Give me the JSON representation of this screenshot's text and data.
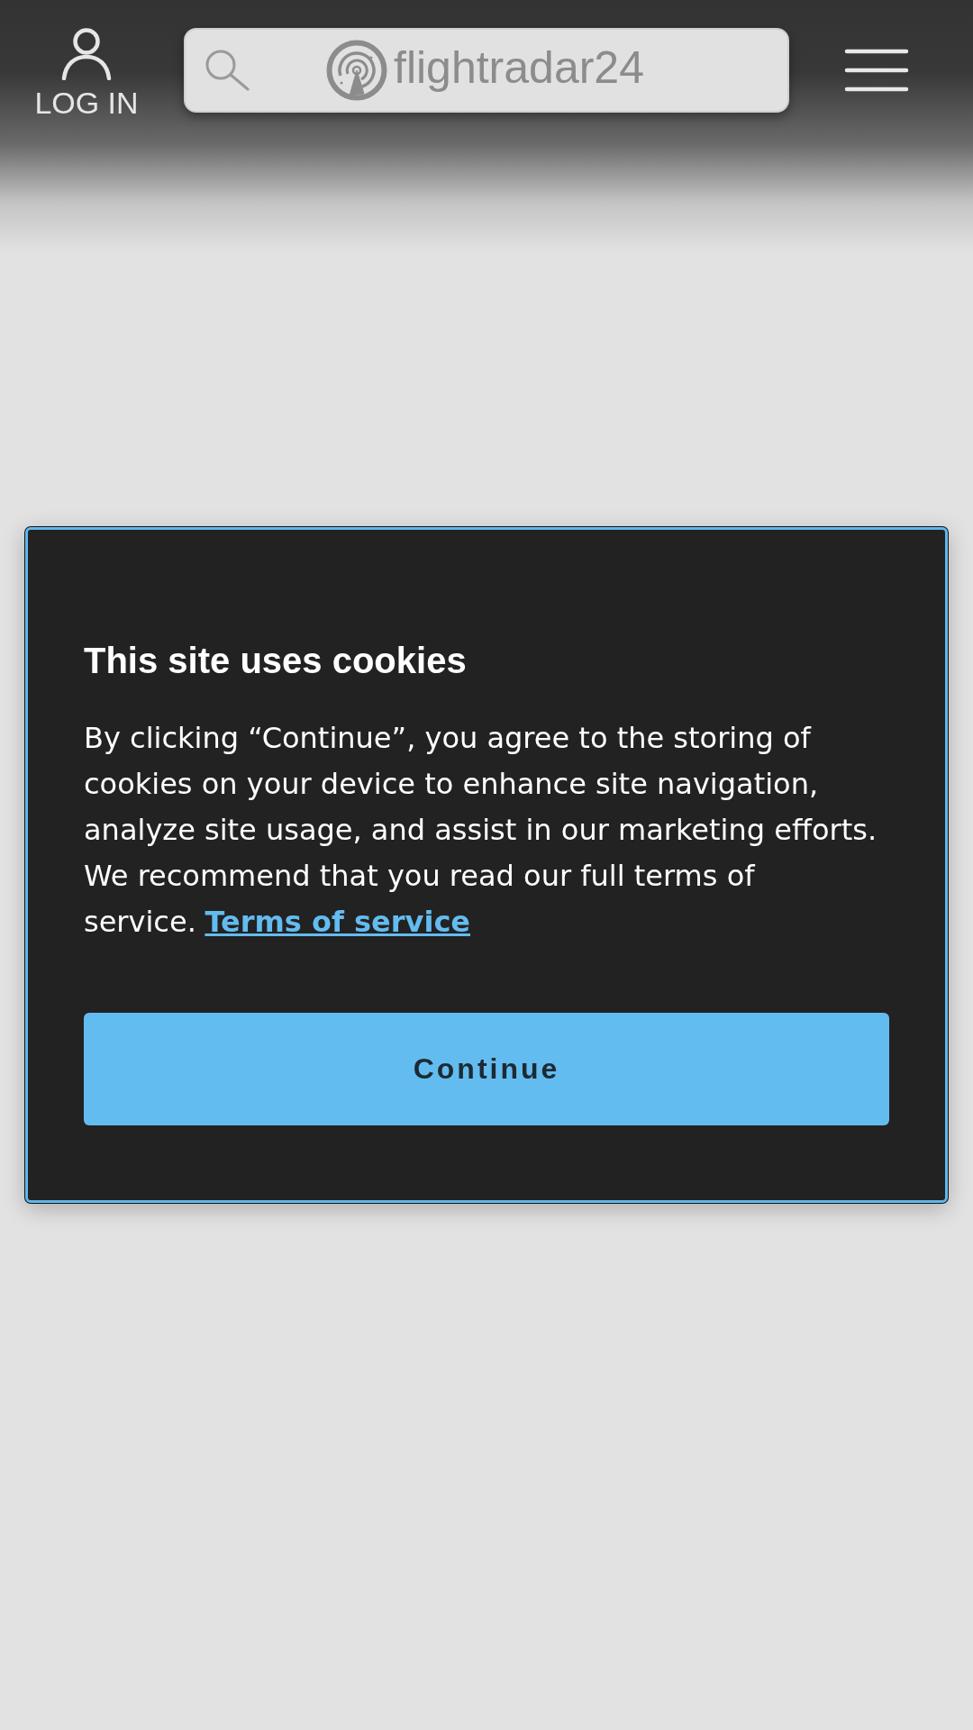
{
  "header": {
    "login_label": "LOG IN",
    "logo": "flightradar24"
  },
  "cookie_dialog": {
    "title": "This site uses cookies",
    "body": "By clicking “Continue”, you agree to the storing of cookies on your device to enhance site navigation, analyze site usage, and assist in our marketing efforts. We recommend that you read our full terms of service.",
    "link": "Terms of service",
    "button": "Continue"
  }
}
